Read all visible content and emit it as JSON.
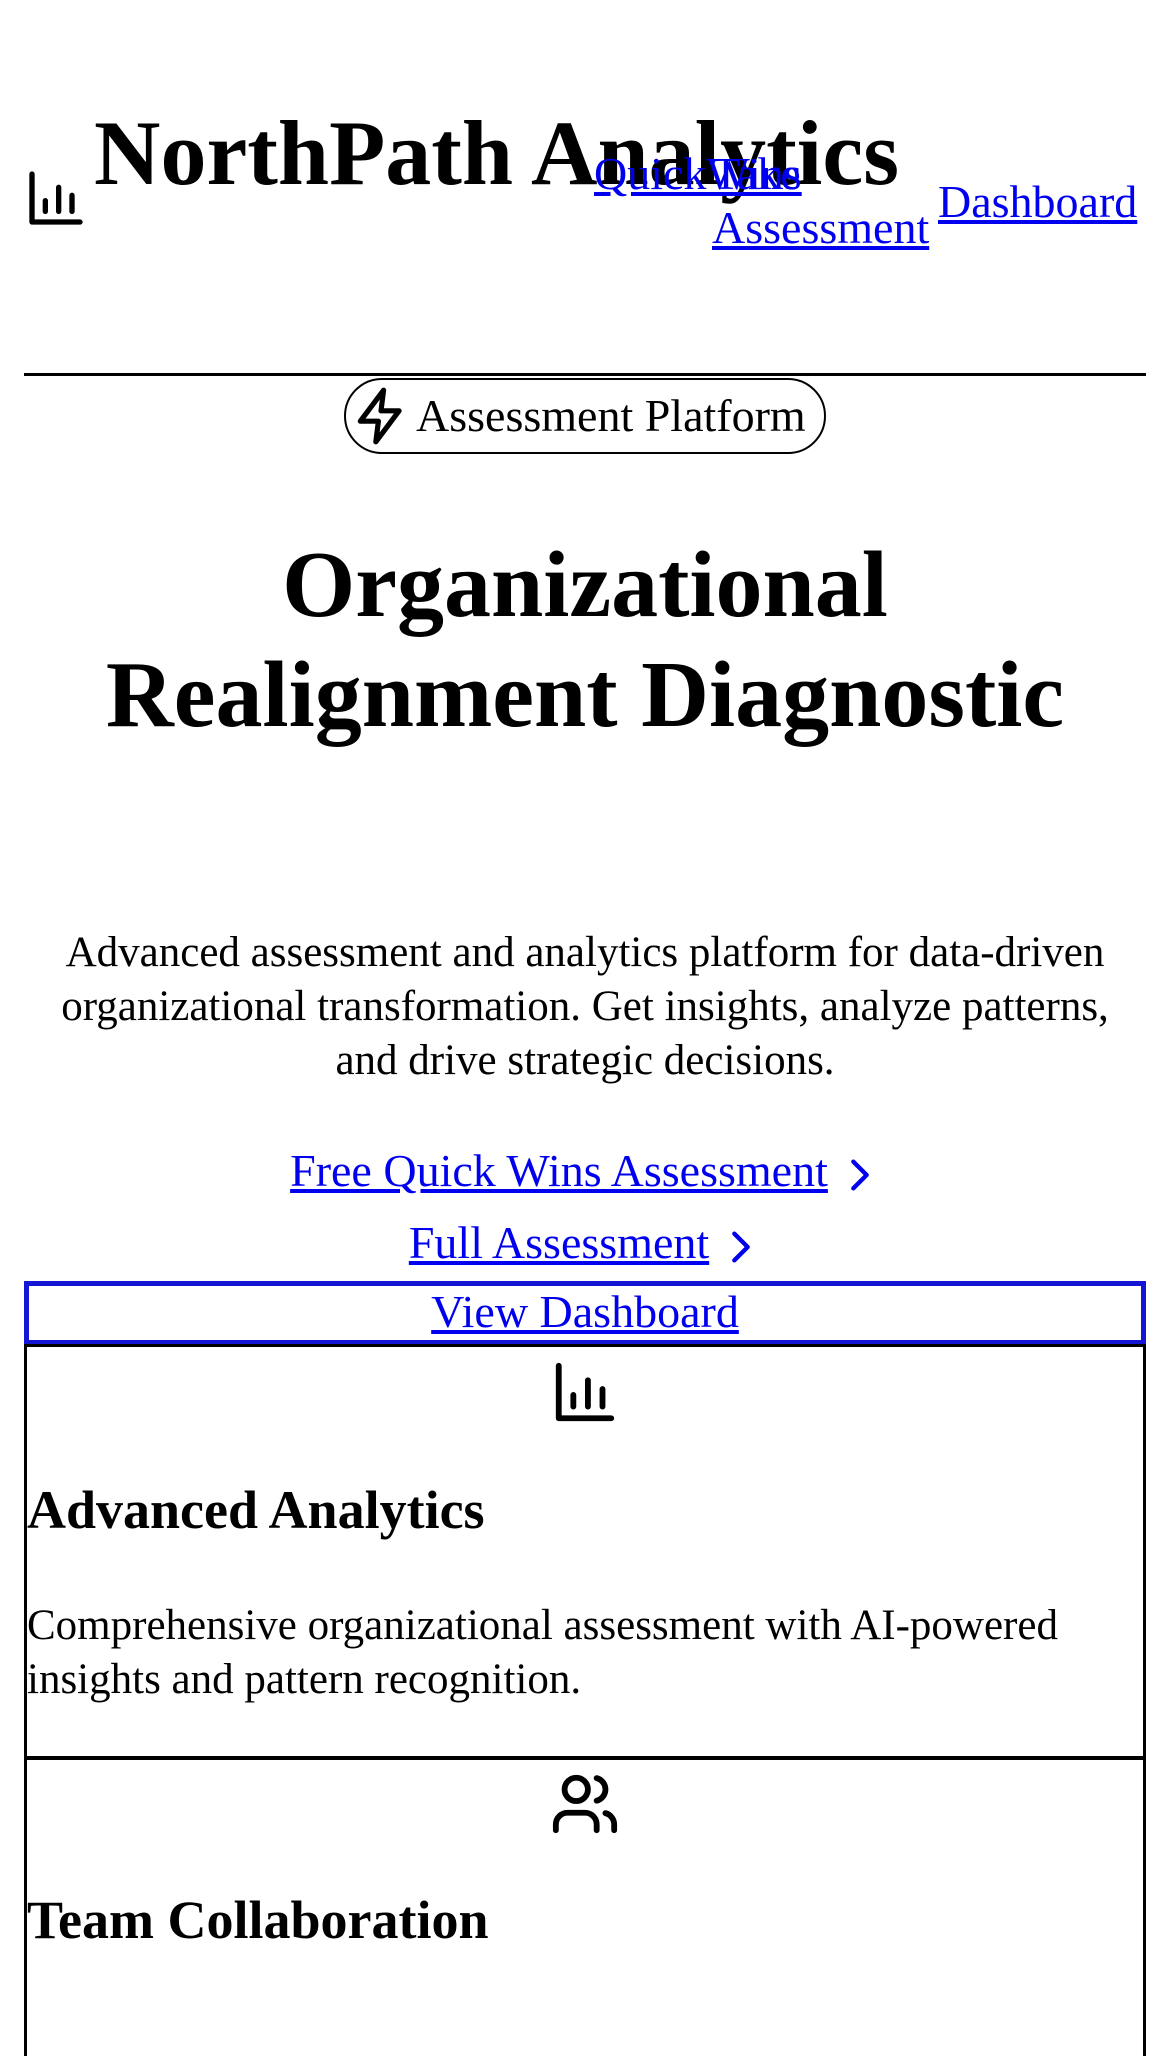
{
  "brand": {
    "name": "NorthPath Analytics",
    "icon": "bar-chart-icon"
  },
  "nav": {
    "items": [
      {
        "label": "QuickWins"
      },
      {
        "label": "Take Assessment"
      },
      {
        "label": "Dashboard"
      }
    ]
  },
  "badge": {
    "icon": "lightning-icon",
    "label": "Assessment Platform"
  },
  "hero": {
    "title": "Organizational Realignment Diagnostic",
    "description": "Advanced assessment and analytics platform for data-driven organizational transformation. Get insights, analyze patterns, and drive strategic decisions."
  },
  "cta": {
    "quick_wins": "Free Quick Wins Assessment",
    "full": "Full Assessment",
    "dashboard": "View Dashboard"
  },
  "features": [
    {
      "icon": "bar-chart-icon",
      "title": "Advanced Analytics",
      "description": "Comprehensive organizational assessment with AI-powered insights and pattern recognition."
    },
    {
      "icon": "users-icon",
      "title": "Team Collaboration",
      "description": ""
    }
  ],
  "colors": {
    "link": "#0000ee",
    "focus_border": "#1515d6",
    "text": "#000000",
    "background": "#ffffff"
  }
}
